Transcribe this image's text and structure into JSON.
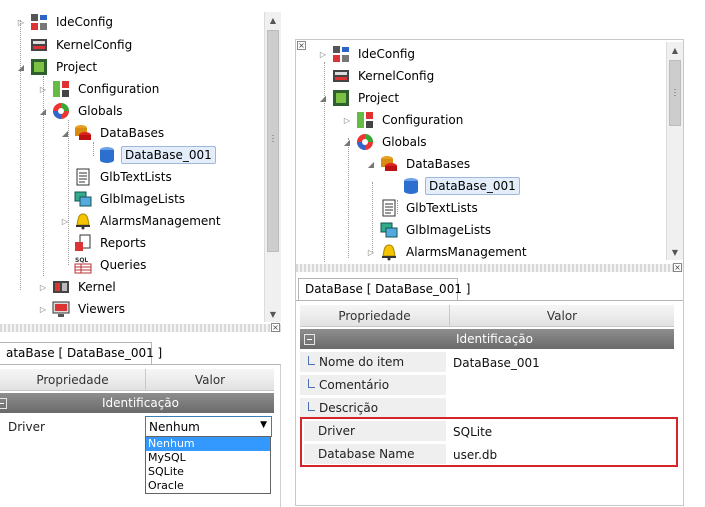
{
  "left": {
    "tree": [
      {
        "label": "IdeConfig",
        "icon": "ide-config-icon"
      },
      {
        "label": "KernelConfig",
        "icon": "kernel-config-icon"
      },
      {
        "label": "Project",
        "icon": "project-icon"
      },
      {
        "label": "Configuration",
        "icon": "configuration-icon"
      },
      {
        "label": "Globals",
        "icon": "globals-icon"
      },
      {
        "label": "DataBases",
        "icon": "databases-icon"
      },
      {
        "label": "DataBase_001",
        "icon": "database-icon"
      },
      {
        "label": "GlbTextLists",
        "icon": "text-lists-icon"
      },
      {
        "label": "GlbImageLists",
        "icon": "image-lists-icon"
      },
      {
        "label": "AlarmsManagement",
        "icon": "alarm-bell-icon"
      },
      {
        "label": "Reports",
        "icon": "reports-icon"
      },
      {
        "label": "Queries",
        "icon": "sql-queries-icon"
      },
      {
        "label": "Kernel",
        "icon": "kernel-icon"
      },
      {
        "label": "Viewers",
        "icon": "viewers-icon"
      }
    ],
    "tab_label": "ataBase [ DataBase_001 ]",
    "grid": {
      "header_property": "Propriedade",
      "header_value": "Valor",
      "category": "Identificação",
      "driver_name": "Driver",
      "driver_value": "Nenhum",
      "driver_options": [
        "Nenhum",
        "MySQL",
        "SQLite",
        "Oracle"
      ]
    }
  },
  "right": {
    "tree": [
      {
        "label": "IdeConfig",
        "icon": "ide-config-icon"
      },
      {
        "label": "KernelConfig",
        "icon": "kernel-config-icon"
      },
      {
        "label": "Project",
        "icon": "project-icon"
      },
      {
        "label": "Configuration",
        "icon": "configuration-icon"
      },
      {
        "label": "Globals",
        "icon": "globals-icon"
      },
      {
        "label": "DataBases",
        "icon": "databases-icon"
      },
      {
        "label": "DataBase_001",
        "icon": "database-icon"
      },
      {
        "label": "GlbTextLists",
        "icon": "text-lists-icon"
      },
      {
        "label": "GlbImageLists",
        "icon": "image-lists-icon"
      },
      {
        "label": "AlarmsManagement",
        "icon": "alarm-bell-icon"
      }
    ],
    "tab_label": "DataBase [ DataBase_001 ]",
    "grid": {
      "header_property": "Propriedade",
      "header_value": "Valor",
      "category": "Identificação",
      "rows": [
        {
          "name": "Nome do item",
          "value": "DataBase_001"
        },
        {
          "name": "Comentário",
          "value": ""
        },
        {
          "name": "Descrição",
          "value": ""
        },
        {
          "name": "Driver",
          "value": "SQLite"
        },
        {
          "name": "Database Name",
          "value": "user.db"
        }
      ]
    }
  },
  "colors": {
    "highlight": "#d4252a",
    "selection": "#3399ff",
    "category_bar": "#7a7a7a"
  }
}
